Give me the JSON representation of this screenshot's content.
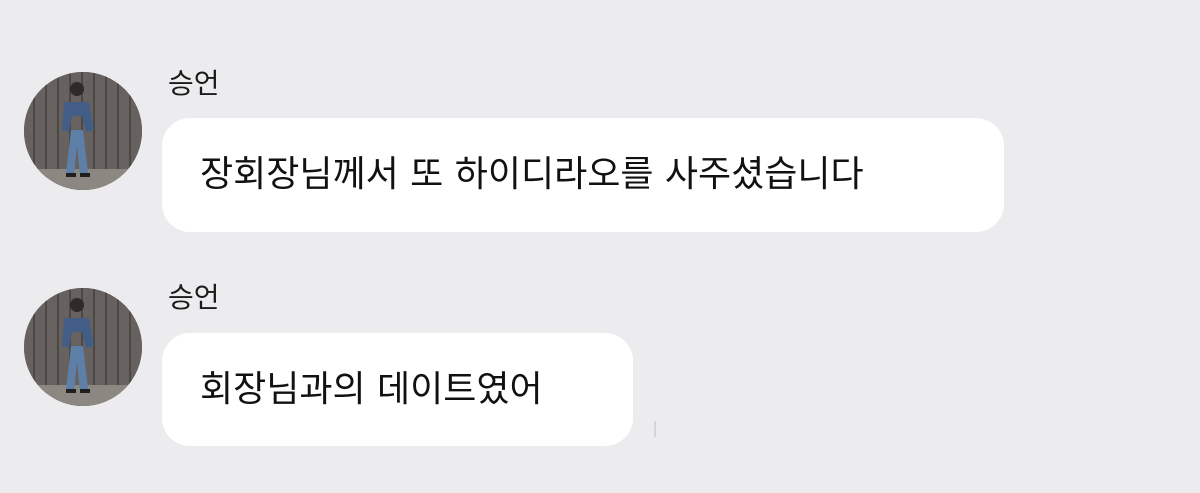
{
  "colors": {
    "background": "#ececee",
    "bubble": "#ffffff",
    "text": "#111111"
  },
  "messages": [
    {
      "sender": "승언",
      "text": "장회장님께서 또 하이디라오를 사주셨습니다",
      "avatar_icon": "profile-photo-avatar"
    },
    {
      "sender": "승언",
      "text": "회장님과의 데이트였어",
      "avatar_icon": "profile-photo-avatar"
    }
  ]
}
